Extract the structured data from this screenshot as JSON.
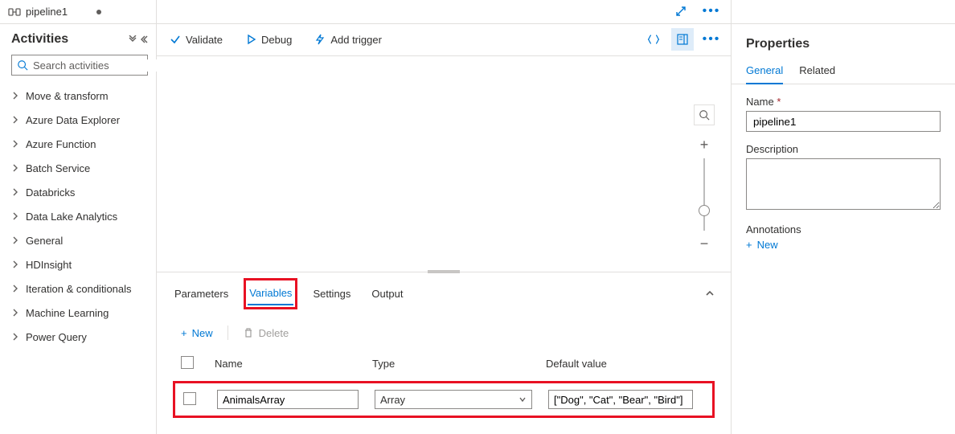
{
  "header": {
    "title": "pipeline1"
  },
  "activities": {
    "title": "Activities",
    "search_placeholder": "Search activities",
    "items": [
      {
        "label": "Move & transform"
      },
      {
        "label": "Azure Data Explorer"
      },
      {
        "label": "Azure Function"
      },
      {
        "label": "Batch Service"
      },
      {
        "label": "Databricks"
      },
      {
        "label": "Data Lake Analytics"
      },
      {
        "label": "General"
      },
      {
        "label": "HDInsight"
      },
      {
        "label": "Iteration & conditionals"
      },
      {
        "label": "Machine Learning"
      },
      {
        "label": "Power Query"
      }
    ]
  },
  "toolbar": {
    "validate": "Validate",
    "debug": "Debug",
    "add_trigger": "Add trigger"
  },
  "bottom_panel": {
    "tabs": {
      "parameters": "Parameters",
      "variables": "Variables",
      "settings": "Settings",
      "output": "Output"
    },
    "actions": {
      "new": "New",
      "delete": "Delete"
    },
    "columns": {
      "name": "Name",
      "type": "Type",
      "default": "Default value"
    },
    "row": {
      "name": "AnimalsArray",
      "type": "Array",
      "default": "[\"Dog\", \"Cat\", \"Bear\", \"Bird\"]"
    }
  },
  "properties": {
    "title": "Properties",
    "tabs": {
      "general": "General",
      "related": "Related"
    },
    "name_label": "Name",
    "name_value": "pipeline1",
    "description_label": "Description",
    "description_value": "",
    "annotations_label": "Annotations",
    "new_label": "New"
  }
}
